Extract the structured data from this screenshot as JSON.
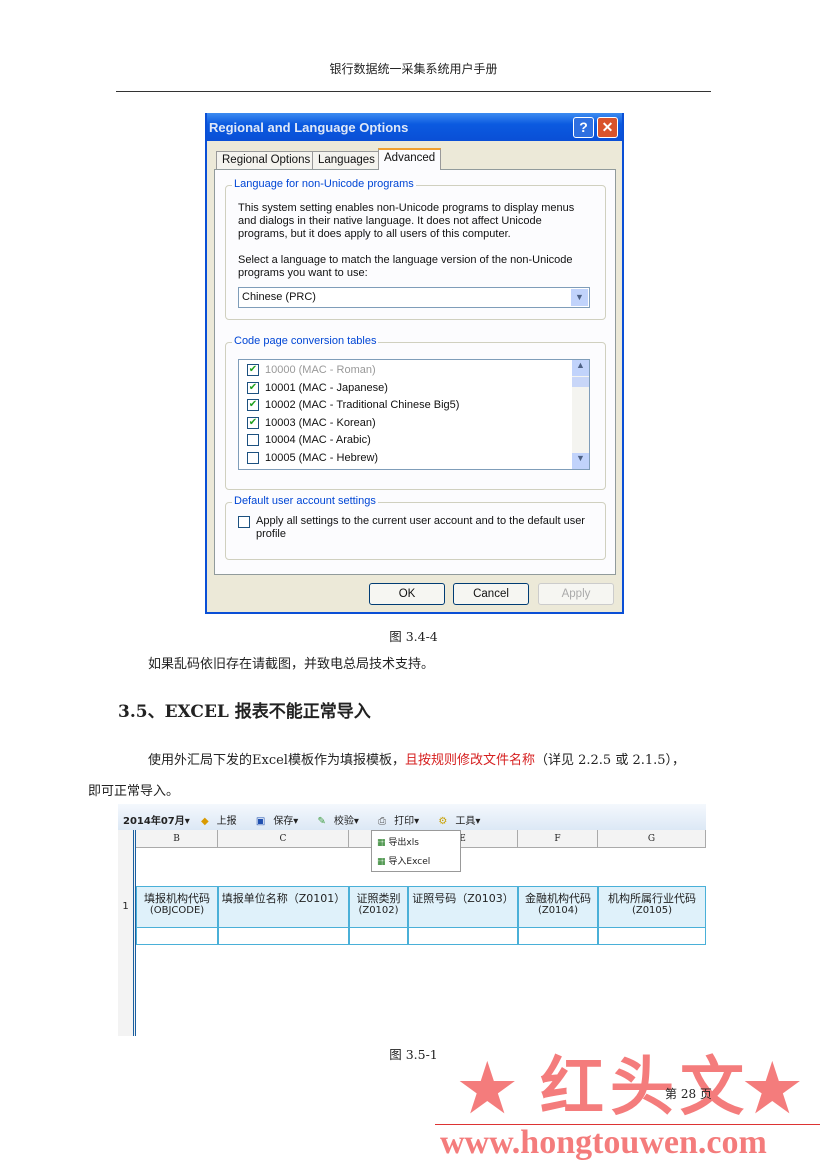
{
  "header": {
    "title": "银行数据统一采集系统用户手册"
  },
  "dialog": {
    "title": "Regional and Language Options",
    "help": "?",
    "close": "✕",
    "tabs": [
      "Regional Options",
      "Languages",
      "Advanced"
    ],
    "active_tab": "Advanced",
    "group1": {
      "legend": "Language for non-Unicode programs",
      "desc": "This system setting enables non-Unicode programs to display menus and dialogs in their native language. It does not affect Unicode programs, but it does apply to all users of this computer.",
      "prompt": "Select a language to match the language version of the non-Unicode programs you want to use:",
      "selected": "Chinese (PRC)"
    },
    "group2": {
      "legend": "Code page conversion tables",
      "items": [
        {
          "label": "10000 (MAC - Roman)",
          "checked": true,
          "disabled": true
        },
        {
          "label": "10001 (MAC - Japanese)",
          "checked": true
        },
        {
          "label": "10002 (MAC - Traditional Chinese Big5)",
          "checked": true
        },
        {
          "label": "10003 (MAC - Korean)",
          "checked": true
        },
        {
          "label": "10004 (MAC - Arabic)",
          "checked": false
        },
        {
          "label": "10005 (MAC - Hebrew)",
          "checked": false
        }
      ]
    },
    "group3": {
      "legend": "Default user account settings",
      "label": "Apply all settings to the current user account and to the default user profile",
      "checked": false
    },
    "buttons": {
      "ok": "OK",
      "cancel": "Cancel",
      "apply": "Apply"
    }
  },
  "caption1": "图 3.4-4",
  "para1": "如果乱码依旧存在请截图，并致电总局技术支持。",
  "section": "3.5、EXCEL 报表不能正常导入",
  "para2": {
    "a": "使用外汇局下发的Excel模板作为填报模板，",
    "b": "且按规则修改文件名称",
    "c": "（详见 2.2.5 或 2.1.5），",
    "d": "即可正常导入。",
    "accent": "#d62020"
  },
  "sheet": {
    "toolbar": [
      "2014年07月▾",
      "上报",
      "保存▾",
      "校验▾",
      "打印▾",
      "工具▾"
    ],
    "menu": [
      "导出xls",
      "导入Excel"
    ],
    "cols": [
      "B",
      "C",
      "D",
      "E",
      "F",
      "G"
    ],
    "row": "1",
    "headers": [
      [
        "填报机构代码",
        "(OBJCODE)"
      ],
      [
        "填报单位名称（Z0101）",
        ""
      ],
      [
        "证照类别",
        "(Z0102)"
      ],
      [
        "证照号码（Z0103）",
        ""
      ],
      [
        "金融机构代码",
        "(Z0104)"
      ],
      [
        "机构所属行业代码",
        "(Z0105)"
      ]
    ]
  },
  "caption2": "图 3.5-1",
  "footer": {
    "page": "第 28 页"
  },
  "watermark": {
    "text": "红头文",
    "url": "www.hongtouwen.com",
    "color": "#f47c7c"
  }
}
